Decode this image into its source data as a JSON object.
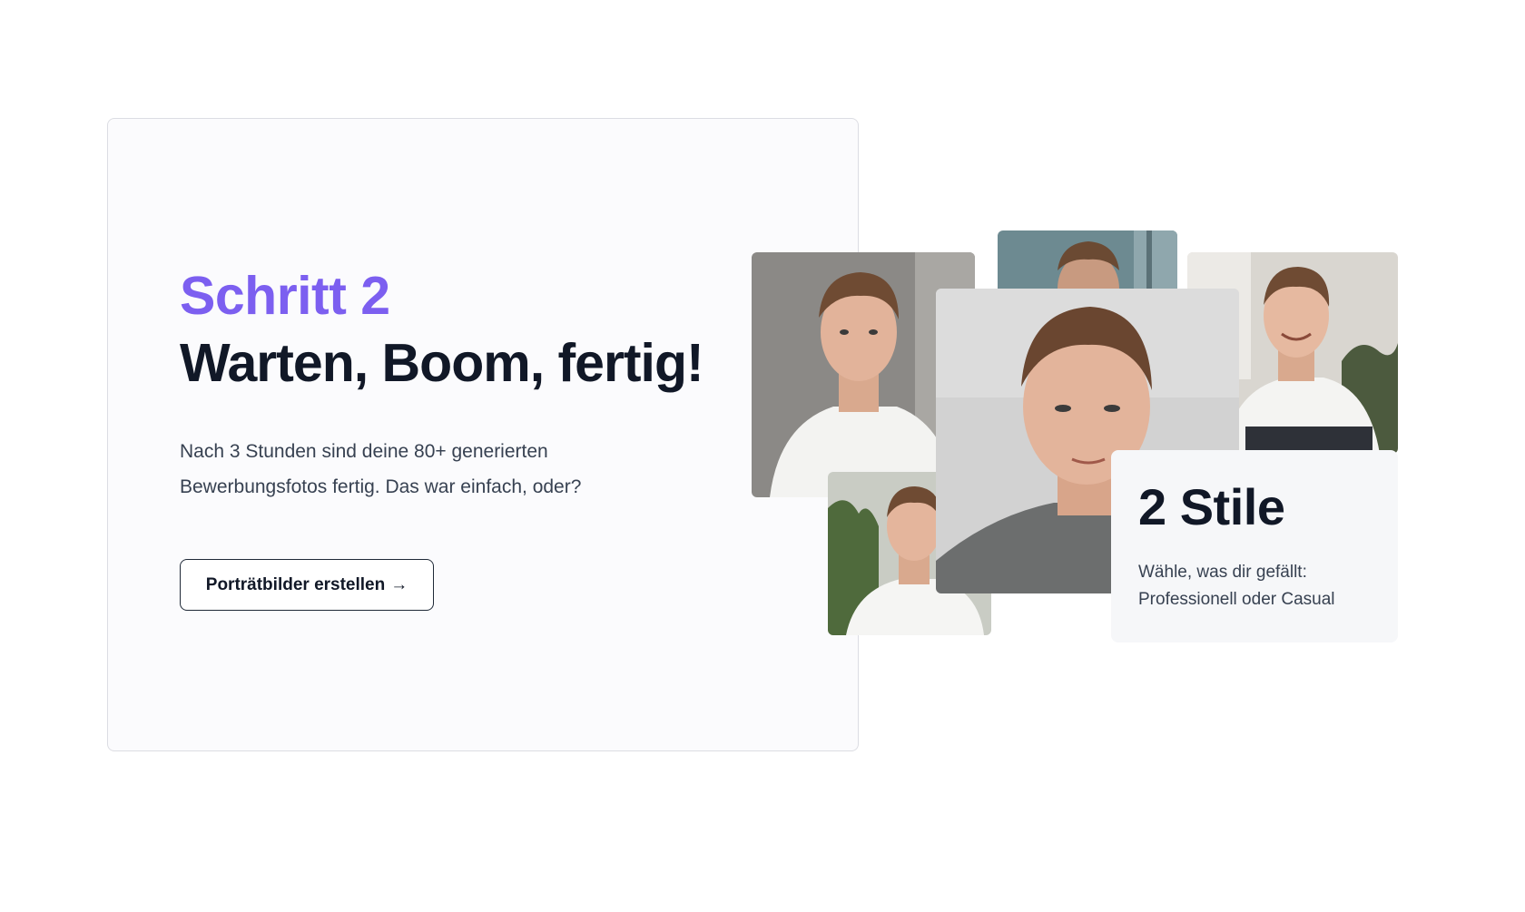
{
  "step": {
    "label": "Schritt 2",
    "title": "Warten, Boom, fertig!",
    "description_lines": [
      "Nach 3 Stunden sind deine 80+ generierten",
      "Bewerbungsfotos fertig. Das war einfach, oder?"
    ],
    "cta_label": "Porträtbilder erstellen",
    "cta_icon": "arrow-right-icon",
    "cta_glyph": "→"
  },
  "styles_card": {
    "title": "2 Stile",
    "description_lines": [
      "Wähle, was dir gefällt:",
      "Professionell oder Casual"
    ]
  },
  "colors": {
    "accent": "#7c5ff0",
    "heading": "#111827",
    "body_text": "#374151",
    "card_background": "#fbfbfd"
  }
}
